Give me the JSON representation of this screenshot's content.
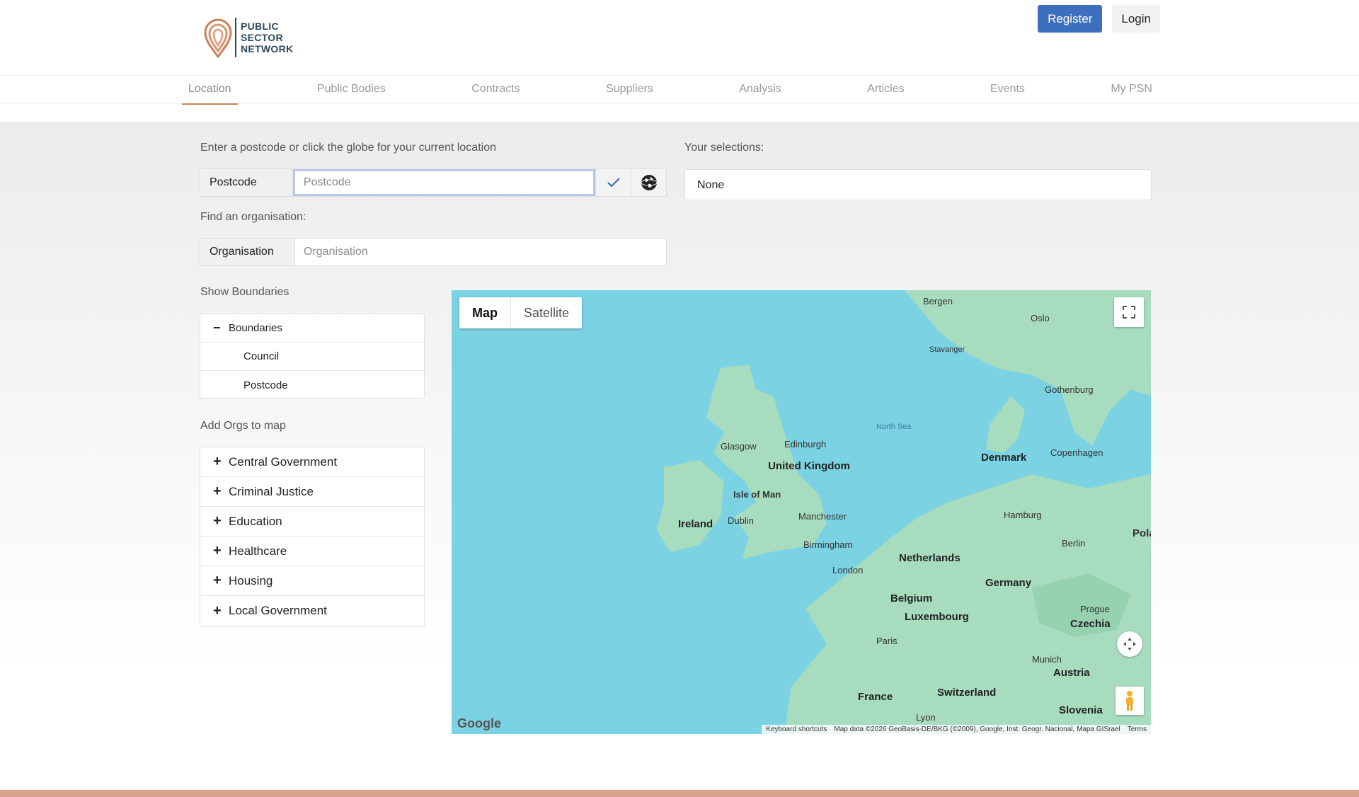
{
  "brand": {
    "line1": "PUBLIC",
    "line2": "SECTOR",
    "line3": "NETWORK"
  },
  "auth": {
    "register": "Register",
    "login": "Login"
  },
  "nav": [
    {
      "label": "Location",
      "active": true
    },
    {
      "label": "Public Bodies"
    },
    {
      "label": "Contracts"
    },
    {
      "label": "Suppliers"
    },
    {
      "label": "Analysis"
    },
    {
      "label": "Articles"
    },
    {
      "label": "Events"
    },
    {
      "label": "My PSN"
    }
  ],
  "location": {
    "instruction": "Enter a postcode or click the globe for your current location",
    "postcode_label": "Postcode",
    "postcode_placeholder": "Postcode",
    "find_label": "Find an organisation:",
    "org_label": "Organisation",
    "org_placeholder": "Organisation"
  },
  "selections": {
    "label": "Your selections:",
    "value": "None"
  },
  "boundaries": {
    "heading": "Show Boundaries",
    "root": "Boundaries",
    "items": [
      "Council",
      "Postcode"
    ]
  },
  "orgs": {
    "heading": "Add Orgs to map",
    "items": [
      "Central Government",
      "Criminal Justice",
      "Education",
      "Healthcare",
      "Housing",
      "Local Government"
    ]
  },
  "map": {
    "type_map": "Map",
    "type_satellite": "Satellite",
    "google": "Google",
    "attr_shortcuts": "Keyboard shortcuts",
    "attr_data": "Map data ©2026 GeoBasis-DE/BKG (©2009), Google, Inst. Geogr. Nacional, Mapa GISrael",
    "attr_terms": "Terms",
    "labels": {
      "bergen": "Bergen",
      "oslo": "Oslo",
      "stavanger": "Stavanger",
      "gothenburg": "Gothenburg",
      "north_sea": "North Sea",
      "edinburgh": "Edinburgh",
      "glasgow": "Glasgow",
      "uk": "United Kingdom",
      "isle_of_man": "Isle of Man",
      "denmark": "Denmark",
      "copenhagen": "Copenhagen",
      "ireland": "Ireland",
      "dublin": "Dublin",
      "manchester": "Manchester",
      "hamburg": "Hamburg",
      "birmingham": "Birmingham",
      "berlin": "Berlin",
      "netherlands": "Netherlands",
      "london": "London",
      "germany": "Germany",
      "belgium": "Belgium",
      "luxembourg": "Luxembourg",
      "prague": "Prague",
      "czechia": "Czechia",
      "paris": "Paris",
      "munich": "Munich",
      "austria": "Austria",
      "france": "France",
      "switzerland": "Switzerland",
      "slovenia": "Slovenia",
      "lyon": "Lyon",
      "pola": "Pola"
    }
  },
  "colors": {
    "accent": "#3d6fbf",
    "brand": "#c9805a",
    "water": "#7ad2e3",
    "land": "#a8dcbf"
  }
}
